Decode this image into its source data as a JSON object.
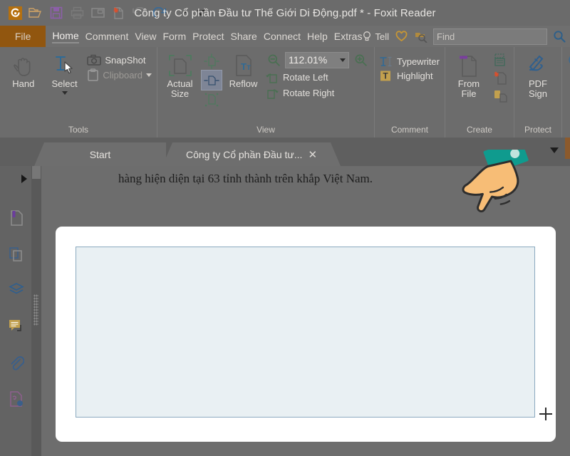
{
  "window": {
    "title": "Công ty Cổ phần Đầu tư Thế Giới Di Động.pdf * - Foxit Reader",
    "app_name": "Foxit Reader",
    "document_name": "Công ty Cổ phần Đầu tư Thế Giới Di Động.pdf",
    "modified_marker": "*"
  },
  "quick_access": [
    {
      "name": "foxit-logo-icon",
      "label": "Foxit"
    },
    {
      "name": "open-icon",
      "label": "Open"
    },
    {
      "name": "save-icon",
      "label": "Save"
    },
    {
      "name": "print-icon",
      "label": "Print"
    },
    {
      "name": "email-icon",
      "label": "Email"
    },
    {
      "name": "new-from-file-icon",
      "label": "Create PDF"
    },
    {
      "name": "undo-icon",
      "label": "Undo"
    },
    {
      "name": "redo-icon",
      "label": "Redo"
    },
    {
      "name": "customize-toolbar-icon",
      "label": "Customize"
    },
    {
      "name": "more-icon",
      "label": "More"
    }
  ],
  "menubar": {
    "file_label": "File",
    "items": [
      {
        "label": "Home",
        "active": true
      },
      {
        "label": "Comment",
        "active": false
      },
      {
        "label": "View",
        "active": false
      },
      {
        "label": "Form",
        "active": false
      },
      {
        "label": "Protect",
        "active": false
      },
      {
        "label": "Share",
        "active": false
      },
      {
        "label": "Connect",
        "active": false
      },
      {
        "label": "Help",
        "active": false
      },
      {
        "label": "Extras",
        "active": false
      }
    ],
    "tell_label": "Tell",
    "find_placeholder": "Find",
    "find_value": ""
  },
  "ribbon": {
    "groups": [
      {
        "title": "Tools",
        "hand_label": "Hand",
        "select_label": "Select",
        "snapshot_label": "SnapShot",
        "clipboard_label": "Clipboard",
        "clipboard_disabled": true
      },
      {
        "title": "View",
        "actual_size_label": "Actual Size",
        "actual_size_line1": "Actual",
        "actual_size_line2": "Size",
        "reflow_label": "Reflow",
        "zoom_value": "112.01%",
        "rotate_left_label": "Rotate Left",
        "rotate_right_label": "Rotate Right",
        "fit_page_label": "Fit Page",
        "fit_width_label": "Fit Width",
        "fit_visible_label": "Fit Visible"
      },
      {
        "title": "Comment",
        "typewriter_label": "Typewriter",
        "highlight_label": "Highlight"
      },
      {
        "title": "Create",
        "from_file_label": "From File",
        "from_file_line1": "From",
        "from_file_line2": "File",
        "from_scanner_label": "From Scanner",
        "blank_label": "Blank",
        "from_clipboard_label": "From Clipboard"
      },
      {
        "title": "Protect",
        "pdf_sign_label": "PDF Sign",
        "pdf_sign_line1": "PDF",
        "pdf_sign_line2": "Sign"
      }
    ]
  },
  "tabs": {
    "items": [
      {
        "label": "Start",
        "active": false,
        "closable": false
      },
      {
        "label": "Công ty Cổ phần Đầu tư...",
        "active": true,
        "closable": true
      }
    ],
    "close_glyph": "✕"
  },
  "sidebar": {
    "items": [
      {
        "name": "bookmarks-icon",
        "label": "Bookmarks"
      },
      {
        "name": "page-thumbnails-icon",
        "label": "Page Thumbnails"
      },
      {
        "name": "layers-icon",
        "label": "Layers"
      },
      {
        "name": "comments-icon",
        "label": "Comments"
      },
      {
        "name": "attachments-icon",
        "label": "Attachments"
      },
      {
        "name": "digital-signatures-icon",
        "label": "Digital Signatures"
      }
    ]
  },
  "document": {
    "visible_line": "hàng hiện diện tại 63 tỉnh thành trên khắp Việt Nam."
  },
  "overlay": {
    "card_present": true,
    "selection_label": "Snapshot selection region",
    "cursor": "crosshair",
    "pointer_hand_label": "pointing-hand-illustration"
  },
  "colors": {
    "scrim": "#686868",
    "file_tab": "#91560f",
    "selection_fill": "#e9f0f3",
    "selection_border": "#8ba9bf",
    "card_background": "#ffffff",
    "hand_skin": "#f7bd76",
    "hand_sleeve": "#0f9b8e",
    "accent_orange": "#8c5a2c"
  }
}
